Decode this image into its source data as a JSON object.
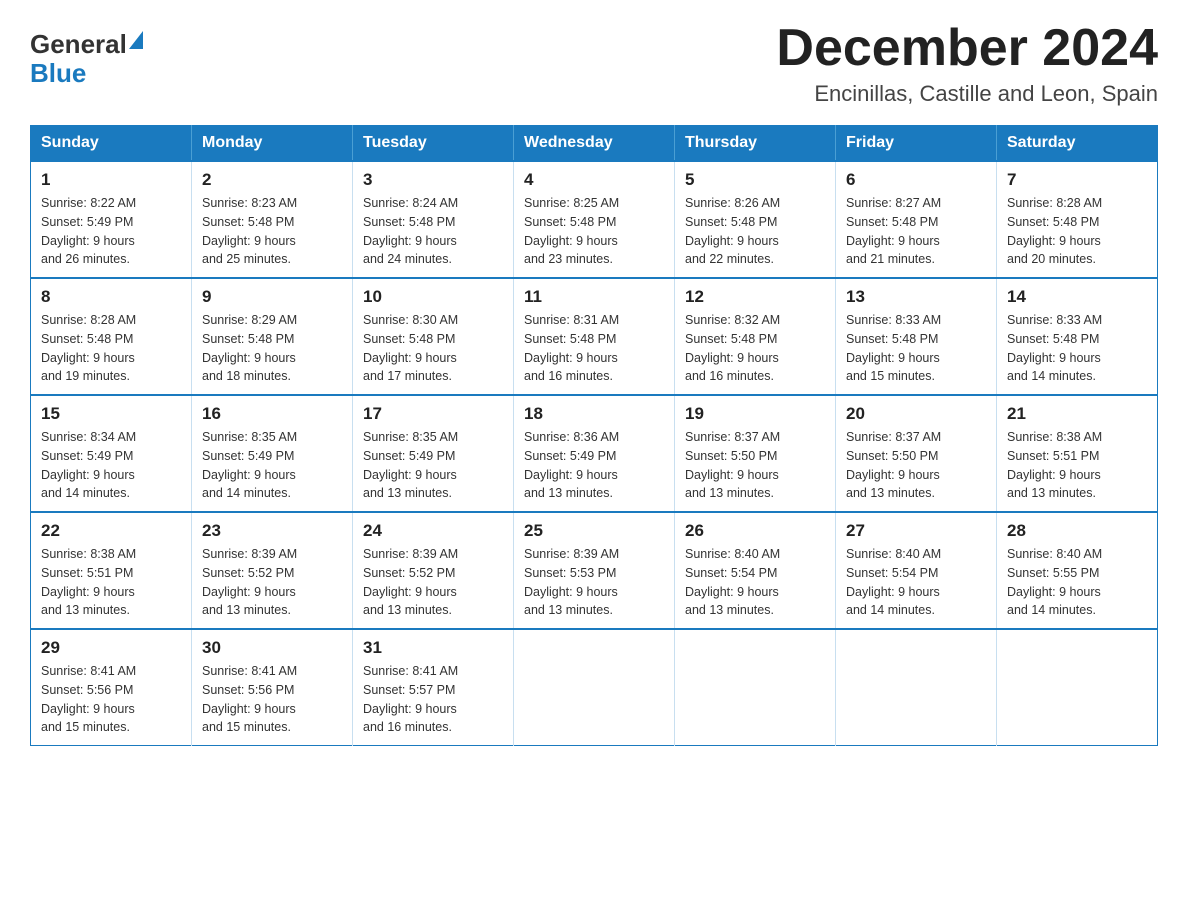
{
  "header": {
    "logo": {
      "general": "General",
      "blue": "Blue"
    },
    "title": "December 2024",
    "location": "Encinillas, Castille and Leon, Spain"
  },
  "weekdays": [
    "Sunday",
    "Monday",
    "Tuesday",
    "Wednesday",
    "Thursday",
    "Friday",
    "Saturday"
  ],
  "weeks": [
    [
      {
        "day": "1",
        "sunrise": "8:22 AM",
        "sunset": "5:49 PM",
        "daylight": "9 hours and 26 minutes."
      },
      {
        "day": "2",
        "sunrise": "8:23 AM",
        "sunset": "5:48 PM",
        "daylight": "9 hours and 25 minutes."
      },
      {
        "day": "3",
        "sunrise": "8:24 AM",
        "sunset": "5:48 PM",
        "daylight": "9 hours and 24 minutes."
      },
      {
        "day": "4",
        "sunrise": "8:25 AM",
        "sunset": "5:48 PM",
        "daylight": "9 hours and 23 minutes."
      },
      {
        "day": "5",
        "sunrise": "8:26 AM",
        "sunset": "5:48 PM",
        "daylight": "9 hours and 22 minutes."
      },
      {
        "day": "6",
        "sunrise": "8:27 AM",
        "sunset": "5:48 PM",
        "daylight": "9 hours and 21 minutes."
      },
      {
        "day": "7",
        "sunrise": "8:28 AM",
        "sunset": "5:48 PM",
        "daylight": "9 hours and 20 minutes."
      }
    ],
    [
      {
        "day": "8",
        "sunrise": "8:28 AM",
        "sunset": "5:48 PM",
        "daylight": "9 hours and 19 minutes."
      },
      {
        "day": "9",
        "sunrise": "8:29 AM",
        "sunset": "5:48 PM",
        "daylight": "9 hours and 18 minutes."
      },
      {
        "day": "10",
        "sunrise": "8:30 AM",
        "sunset": "5:48 PM",
        "daylight": "9 hours and 17 minutes."
      },
      {
        "day": "11",
        "sunrise": "8:31 AM",
        "sunset": "5:48 PM",
        "daylight": "9 hours and 16 minutes."
      },
      {
        "day": "12",
        "sunrise": "8:32 AM",
        "sunset": "5:48 PM",
        "daylight": "9 hours and 16 minutes."
      },
      {
        "day": "13",
        "sunrise": "8:33 AM",
        "sunset": "5:48 PM",
        "daylight": "9 hours and 15 minutes."
      },
      {
        "day": "14",
        "sunrise": "8:33 AM",
        "sunset": "5:48 PM",
        "daylight": "9 hours and 14 minutes."
      }
    ],
    [
      {
        "day": "15",
        "sunrise": "8:34 AM",
        "sunset": "5:49 PM",
        "daylight": "9 hours and 14 minutes."
      },
      {
        "day": "16",
        "sunrise": "8:35 AM",
        "sunset": "5:49 PM",
        "daylight": "9 hours and 14 minutes."
      },
      {
        "day": "17",
        "sunrise": "8:35 AM",
        "sunset": "5:49 PM",
        "daylight": "9 hours and 13 minutes."
      },
      {
        "day": "18",
        "sunrise": "8:36 AM",
        "sunset": "5:49 PM",
        "daylight": "9 hours and 13 minutes."
      },
      {
        "day": "19",
        "sunrise": "8:37 AM",
        "sunset": "5:50 PM",
        "daylight": "9 hours and 13 minutes."
      },
      {
        "day": "20",
        "sunrise": "8:37 AM",
        "sunset": "5:50 PM",
        "daylight": "9 hours and 13 minutes."
      },
      {
        "day": "21",
        "sunrise": "8:38 AM",
        "sunset": "5:51 PM",
        "daylight": "9 hours and 13 minutes."
      }
    ],
    [
      {
        "day": "22",
        "sunrise": "8:38 AM",
        "sunset": "5:51 PM",
        "daylight": "9 hours and 13 minutes."
      },
      {
        "day": "23",
        "sunrise": "8:39 AM",
        "sunset": "5:52 PM",
        "daylight": "9 hours and 13 minutes."
      },
      {
        "day": "24",
        "sunrise": "8:39 AM",
        "sunset": "5:52 PM",
        "daylight": "9 hours and 13 minutes."
      },
      {
        "day": "25",
        "sunrise": "8:39 AM",
        "sunset": "5:53 PM",
        "daylight": "9 hours and 13 minutes."
      },
      {
        "day": "26",
        "sunrise": "8:40 AM",
        "sunset": "5:54 PM",
        "daylight": "9 hours and 13 minutes."
      },
      {
        "day": "27",
        "sunrise": "8:40 AM",
        "sunset": "5:54 PM",
        "daylight": "9 hours and 14 minutes."
      },
      {
        "day": "28",
        "sunrise": "8:40 AM",
        "sunset": "5:55 PM",
        "daylight": "9 hours and 14 minutes."
      }
    ],
    [
      {
        "day": "29",
        "sunrise": "8:41 AM",
        "sunset": "5:56 PM",
        "daylight": "9 hours and 15 minutes."
      },
      {
        "day": "30",
        "sunrise": "8:41 AM",
        "sunset": "5:56 PM",
        "daylight": "9 hours and 15 minutes."
      },
      {
        "day": "31",
        "sunrise": "8:41 AM",
        "sunset": "5:57 PM",
        "daylight": "9 hours and 16 minutes."
      },
      null,
      null,
      null,
      null
    ]
  ],
  "labels": {
    "sunrise": "Sunrise:",
    "sunset": "Sunset:",
    "daylight": "Daylight:"
  }
}
